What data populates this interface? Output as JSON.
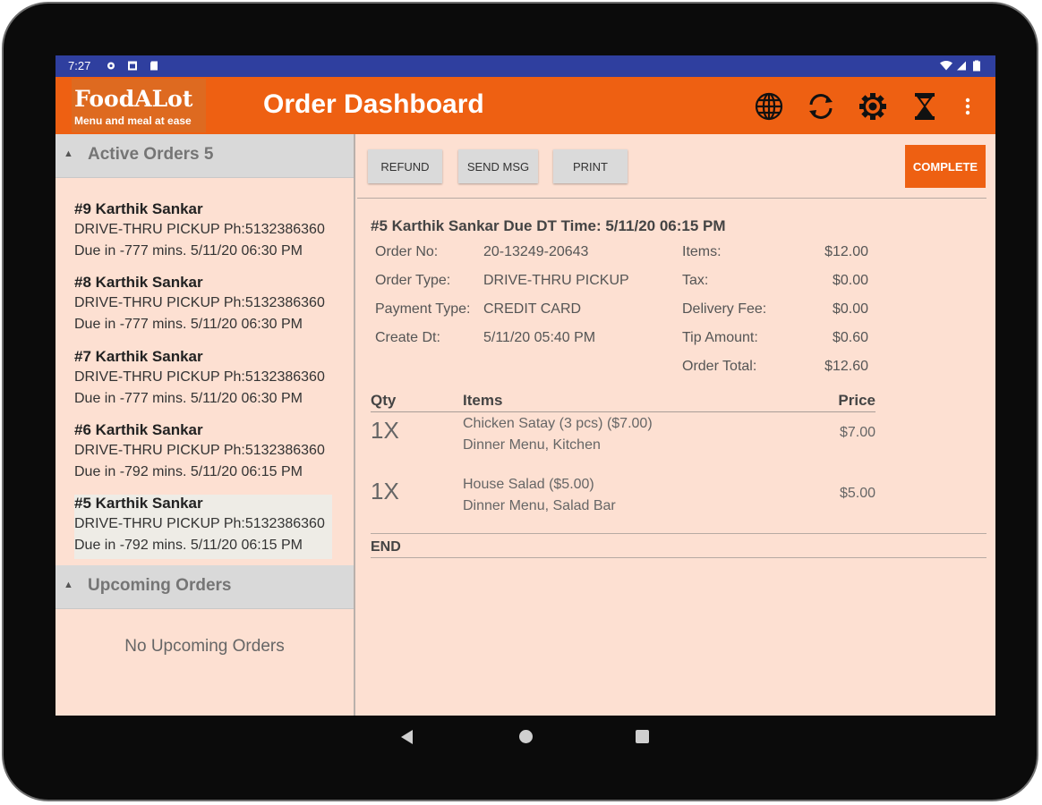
{
  "status_bar": {
    "time": "7:27",
    "left_icons": [
      "gear-icon",
      "image-icon",
      "sd-card-icon"
    ],
    "right_icons": [
      "wifi-icon",
      "signal-icon",
      "battery-icon"
    ]
  },
  "app_bar": {
    "logo_brand": "FoodALot",
    "logo_tagline": "Menu and meal at ease",
    "title": "Order Dashboard",
    "actions": [
      "globe-icon",
      "refresh-icon",
      "settings-icon",
      "hourglass-icon",
      "overflow-menu-icon"
    ]
  },
  "sidebar": {
    "active_header": "Active Orders 5",
    "orders": [
      {
        "name": "#9 Karthik Sankar",
        "line2": "DRIVE-THRU PICKUP Ph:5132386360",
        "line3": "Due in -777 mins. 5/11/20 06:30 PM"
      },
      {
        "name": "#8 Karthik Sankar",
        "line2": "DRIVE-THRU PICKUP Ph:5132386360",
        "line3": "Due in -777 mins. 5/11/20 06:30 PM"
      },
      {
        "name": "#7 Karthik Sankar",
        "line2": "DRIVE-THRU PICKUP Ph:5132386360",
        "line3": "Due in -777 mins. 5/11/20 06:30 PM"
      },
      {
        "name": "#6 Karthik Sankar",
        "line2": "DRIVE-THRU PICKUP Ph:5132386360",
        "line3": "Due in -792 mins. 5/11/20 06:15 PM"
      },
      {
        "name": "#5 Karthik Sankar",
        "line2": "DRIVE-THRU PICKUP Ph:5132386360",
        "line3": "Due in -792 mins. 5/11/20 06:15 PM"
      }
    ],
    "upcoming_header": "Upcoming Orders",
    "upcoming_empty": "No Upcoming Orders"
  },
  "toolbar": {
    "refund": "REFUND",
    "send_msg": "SEND MSG",
    "print": "PRINT",
    "complete": "COMPLETE"
  },
  "order": {
    "heading": "#5 Karthik Sankar Due DT Time: 5/11/20 06:15 PM",
    "fields": [
      {
        "label": "Order No:",
        "value": "20-13249-20643"
      },
      {
        "label": "Order Type:",
        "value": "DRIVE-THRU PICKUP"
      },
      {
        "label": "Payment Type:",
        "value": "CREDIT CARD"
      },
      {
        "label": "Create Dt:",
        "value": "5/11/20 05:40 PM"
      }
    ],
    "totals": [
      {
        "label": "Items:",
        "value": "$12.00"
      },
      {
        "label": "Tax:",
        "value": "$0.00"
      },
      {
        "label": "Delivery Fee:",
        "value": "$0.00"
      },
      {
        "label": "Tip Amount:",
        "value": "$0.60"
      },
      {
        "label": "Order Total:",
        "value": "$12.60"
      }
    ],
    "columns": {
      "qty": "Qty",
      "items": "Items",
      "price": "Price"
    },
    "items": [
      {
        "qty": "1X",
        "name": "Chicken Satay (3 pcs) ($7.00)",
        "sub": "Dinner Menu, Kitchen",
        "price": "$7.00"
      },
      {
        "qty": "1X",
        "name": "House Salad ($5.00)",
        "sub": "Dinner Menu, Salad Bar",
        "price": "$5.00"
      }
    ],
    "end_label": "END"
  },
  "colors": {
    "accent": "#ee6012",
    "status_bar": "#2f3f9f",
    "background": "#fde0d2",
    "section_header": "#d9d9d9",
    "selected_row": "#eeece6"
  },
  "nav_bar": [
    "back-icon",
    "home-icon",
    "recents-icon"
  ]
}
